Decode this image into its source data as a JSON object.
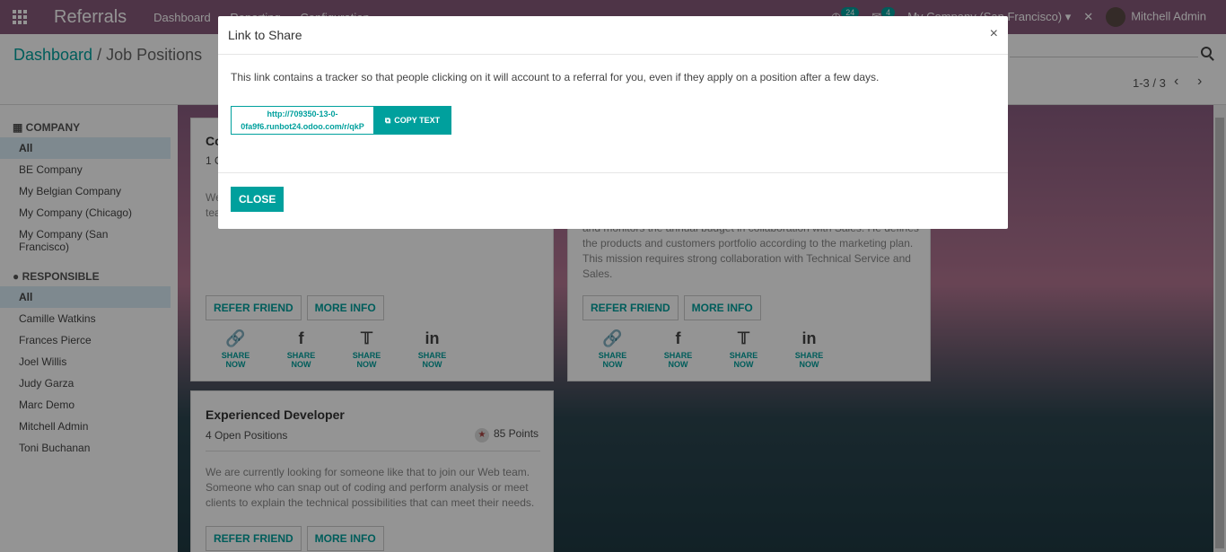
{
  "topbar": {
    "app_name": "Referrals",
    "menu": [
      "Dashboard",
      "Reporting",
      "Configuration"
    ],
    "activity_count": "24",
    "message_count": "4",
    "company": "My Company (San Francisco)",
    "user": "Mitchell Admin"
  },
  "breadcrumb": {
    "parent": "Dashboard",
    "sep": "/",
    "current": "Job Positions"
  },
  "pager": {
    "range": "1-3 / 3"
  },
  "sidebar": {
    "company_header": "COMPANY",
    "companies": [
      "All",
      "BE Company",
      "My Belgian Company",
      "My Company (Chicago)",
      "My Company (San Francisco)"
    ],
    "responsible_header": "RESPONSIBLE",
    "responsibles": [
      "All",
      "Camille Watkins",
      "Frances Pierce",
      "Joel Willis",
      "Judy Garza",
      "Marc Demo",
      "Mitchell Admin",
      "Toni Buchanan"
    ]
  },
  "cards": {
    "c1": {
      "title_frag": "Co",
      "sub_frag": "1 O",
      "desc_frag_1": "We",
      "desc_frag_2": "tea"
    },
    "c2": {
      "desc": "the products and customers portfolio according to the marketing plan. This mission requires strong collaboration with Technical Service and Sales.",
      "desc_top_frag": "and monitors the annual budget in collaboration with Sales. He defines"
    },
    "c3": {
      "title": "Experienced Developer",
      "positions": "4 Open Positions",
      "points": "85 Points",
      "desc": "We are currently looking for someone like that to join our Web team. Someone who can snap out of coding and perform analysis or meet clients to explain the technical possibilities that can meet their needs."
    },
    "refer_label": "REFER FRIEND",
    "info_label": "MORE INFO",
    "share_label": "SHARE NOW",
    "share_icons": [
      "link-icon",
      "facebook-icon",
      "twitter-icon",
      "linkedin-icon"
    ]
  },
  "modal": {
    "title": "Link to Share",
    "close_x": "×",
    "text": "This link contains a tracker so that people clicking on it will account to a referral for you, even if they apply on a position after a few days.",
    "link": "http://709350-13-0-0fa9f6.runbot24.odoo.com/r/qkP",
    "copy_label": "COPY TEXT",
    "close_label": "CLOSE"
  },
  "colors": {
    "brand": "#875a7b",
    "accent": "#00a09d"
  }
}
